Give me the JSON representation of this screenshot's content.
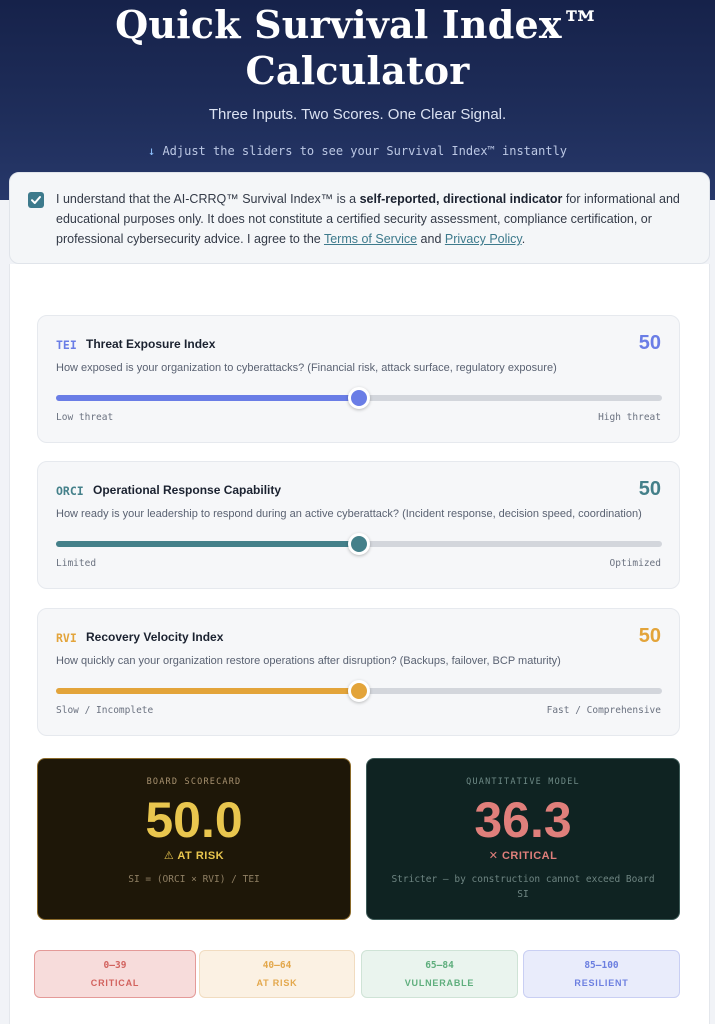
{
  "hero": {
    "title_line1": "Quick Survival Index™",
    "title_line2": "Calculator",
    "tagline": "Three Inputs. Two Scores. One Clear Signal.",
    "hint_arrow": "↓",
    "hint": "Adjust the sliders to see your Survival Index™ instantly"
  },
  "disclaimer": {
    "checked": true,
    "text_before": "I understand that the AI-CRRQ™ Survival Index™ is a ",
    "bold": "self-reported, directional indicator",
    "text_middle": " for informational and educational purposes only. It does not constitute a certified security assessment, compliance certification, or professional cybersecurity advice. I agree to the ",
    "terms_link": "Terms of Service",
    "and": " and ",
    "privacy_link": "Privacy Policy",
    "end": "."
  },
  "sliders": [
    {
      "abbr": "TEI",
      "title": "Threat Exposure Index",
      "value": "50",
      "level": 50,
      "description": "How exposed is your organization to cyberattacks? (Financial risk, attack surface, regulatory exposure)",
      "low_label": "Low threat",
      "high_label": "High threat",
      "color": "#6a7de6"
    },
    {
      "abbr": "ORCI",
      "title": "Operational Response Capability",
      "value": "50",
      "level": 50,
      "description": "How ready is your leadership to respond during an active cyberattack? (Incident response, decision speed, coordination)",
      "low_label": "Limited",
      "high_label": "Optimized",
      "color": "#44808a"
    },
    {
      "abbr": "RVI",
      "title": "Recovery Velocity Index",
      "value": "50",
      "level": 50,
      "description": "How quickly can your organization restore operations after disruption? (Backups, failover, BCP maturity)",
      "low_label": "Slow / Incomplete",
      "high_label": "Fast / Comprehensive",
      "color": "#e3a43a"
    }
  ],
  "scores": {
    "board": {
      "label": "BOARD SCORECARD",
      "value": "50.0",
      "status_icon": "⚠",
      "status": "AT RISK",
      "note": "SI = (ORCI × RVI) / TEI"
    },
    "quant": {
      "label": "QUANTITATIVE MODEL",
      "value": "36.3",
      "status_icon": "✕",
      "status": "CRITICAL",
      "note": "Stricter — by construction cannot exceed Board SI"
    }
  },
  "bands": [
    {
      "range": "0–39",
      "name": "CRITICAL",
      "bg": "#f7dcdb",
      "border": "#e49a98",
      "color": "#d2625e"
    },
    {
      "range": "40–64",
      "name": "AT RISK",
      "bg": "#fbf1e3",
      "border": "#f1dcc0",
      "color": "#e3a84c"
    },
    {
      "range": "65–84",
      "name": "VULNERABLE",
      "bg": "#eaf4ee",
      "border": "#cfe3d6",
      "color": "#5fae7d"
    },
    {
      "range": "85–100",
      "name": "RESILIENT",
      "bg": "#e9ecfb",
      "border": "#c9cff3",
      "color": "#6c7fe0"
    }
  ]
}
